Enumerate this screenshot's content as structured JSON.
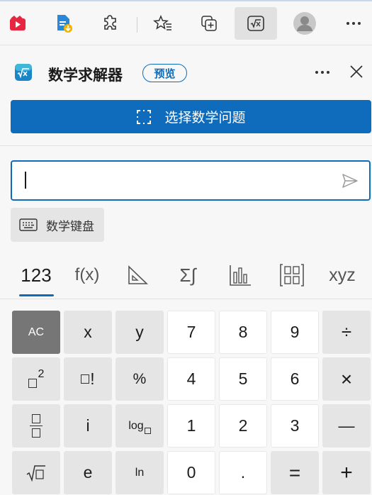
{
  "toolbar": {
    "items": [
      {
        "name": "video-icon",
        "active": false
      },
      {
        "name": "file-download-icon",
        "active": false
      },
      {
        "name": "extensions-icon",
        "active": false
      },
      {
        "name": "favorites-icon",
        "active": false
      },
      {
        "name": "collections-icon",
        "active": false
      },
      {
        "name": "math-solver-icon",
        "active": true
      },
      {
        "name": "profile-avatar-icon",
        "active": false
      },
      {
        "name": "more-options-icon",
        "active": false
      }
    ]
  },
  "header": {
    "title": "数学求解器",
    "badge": "预览"
  },
  "select_problem_label": "选择数学问题",
  "input": {
    "value": "",
    "placeholder": ""
  },
  "keyboard_button_label": "数学键盘",
  "tabs": [
    {
      "label": "123",
      "active": true
    },
    {
      "label": "f(x)",
      "active": false
    },
    {
      "label": "geometry",
      "active": false
    },
    {
      "label": "Σ∫",
      "active": false
    },
    {
      "label": "statistics",
      "active": false
    },
    {
      "label": "matrix",
      "active": false
    },
    {
      "label": "xyz",
      "active": false
    }
  ],
  "keys": {
    "ac": "AC",
    "x": "x",
    "y": "y",
    "k7": "7",
    "k8": "8",
    "k9": "9",
    "div": "÷",
    "pct": "%",
    "k4": "4",
    "k5": "5",
    "k6": "6",
    "mul": "×",
    "i": "i",
    "log": "log",
    "k1": "1",
    "k2": "2",
    "k3": "3",
    "minus": "—",
    "e": "e",
    "ln": "ln",
    "k0": "0",
    "dot": ".",
    "eq": "=",
    "plus": "+",
    "sq_exp": "2",
    "fact": "!"
  },
  "colors": {
    "accent": "#0f6cbd",
    "ac_key": "#767676"
  }
}
